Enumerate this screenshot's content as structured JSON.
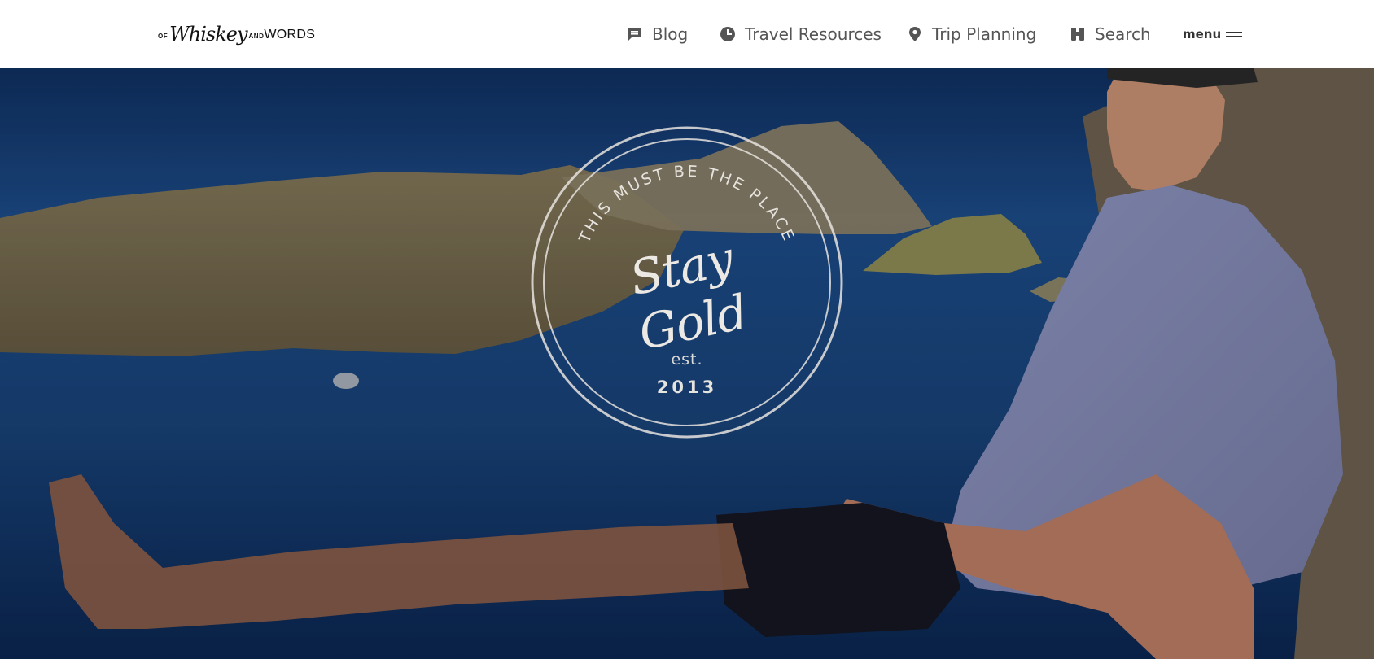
{
  "logo": {
    "prefix": "OF",
    "script": "Whiskey",
    "and": "AND",
    "words": "WORDS"
  },
  "nav": {
    "items": [
      {
        "label": "Blog",
        "icon": "comment-icon"
      },
      {
        "label": "Travel Resources",
        "icon": "clock-icon"
      },
      {
        "label": "Trip Planning",
        "icon": "map-pin-icon"
      },
      {
        "label": "Search",
        "icon": "binoculars-icon"
      }
    ],
    "menu_label": "menu"
  },
  "hero": {
    "emblem": {
      "arc_text": "THIS MUST BE THE PLACE",
      "script_title": "Stay Gold",
      "est_label": "est.",
      "year": "2013"
    }
  },
  "colors": {
    "header_bg": "#ffffff",
    "nav_text": "#555555",
    "sea": "#1f4b86",
    "emblem": "#ece9e4"
  }
}
